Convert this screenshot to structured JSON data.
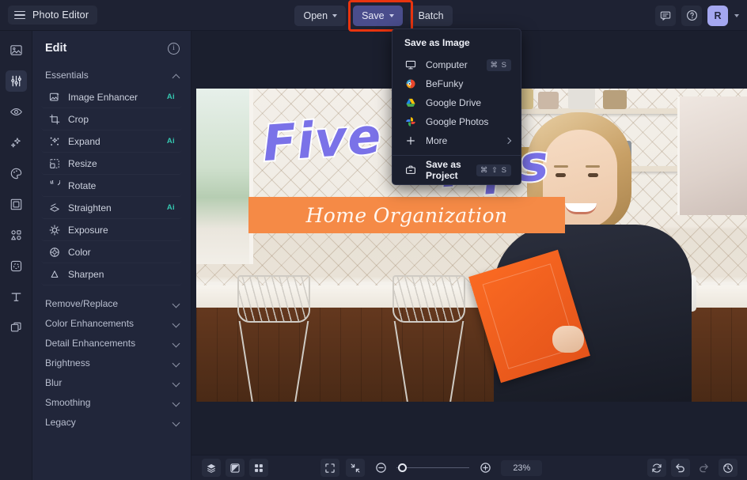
{
  "app": {
    "brand": "Photo Editor",
    "menu_icon": "hamburger-icon"
  },
  "toolbar": {
    "open_label": "Open",
    "save_label": "Save",
    "batch_label": "Batch",
    "highlight_color": "#e8340f",
    "save_active_color": "#4a4d8c"
  },
  "topright": {
    "feedback_icon": "comment-icon",
    "help_icon": "question-circle-icon",
    "avatar_initial": "R",
    "avatar_color": "#a4a7f0"
  },
  "rail": {
    "items": [
      {
        "icon": "image-icon",
        "active": false
      },
      {
        "icon": "sliders-icon",
        "active": true
      },
      {
        "icon": "eye-icon",
        "active": false
      },
      {
        "icon": "sparkles-icon",
        "active": false
      },
      {
        "icon": "palette-icon",
        "active": false
      },
      {
        "icon": "frame-icon",
        "active": false
      },
      {
        "icon": "shapes-icon",
        "active": false
      },
      {
        "icon": "sticker-icon",
        "active": false
      },
      {
        "icon": "text-icon",
        "active": false
      },
      {
        "icon": "layers-icon",
        "active": false
      }
    ]
  },
  "panel": {
    "title": "Edit",
    "info_icon": "info-icon",
    "group_label": "Essentials",
    "group_expanded": true,
    "items": [
      {
        "label": "Image Enhancer",
        "icon": "image-enhancer-icon",
        "badge": "Ai"
      },
      {
        "label": "Crop",
        "icon": "crop-icon",
        "badge": ""
      },
      {
        "label": "Expand",
        "icon": "expand-icon",
        "badge": "Ai"
      },
      {
        "label": "Resize",
        "icon": "resize-icon",
        "badge": ""
      },
      {
        "label": "Rotate",
        "icon": "rotate-icon",
        "badge": ""
      },
      {
        "label": "Straighten",
        "icon": "straighten-icon",
        "badge": "Ai"
      },
      {
        "label": "Exposure",
        "icon": "exposure-icon",
        "badge": ""
      },
      {
        "label": "Color",
        "icon": "color-wheel-icon",
        "badge": ""
      },
      {
        "label": "Sharpen",
        "icon": "sharpen-icon",
        "badge": ""
      }
    ],
    "collapsed_groups": [
      {
        "label": "Remove/Replace"
      },
      {
        "label": "Color Enhancements"
      },
      {
        "label": "Detail Enhancements"
      },
      {
        "label": "Brightness"
      },
      {
        "label": "Blur"
      },
      {
        "label": "Smoothing"
      },
      {
        "label": "Legacy"
      }
    ]
  },
  "save_menu": {
    "title": "Save as Image",
    "items": [
      {
        "label": "Computer",
        "icon": "monitor-icon",
        "shortcut": "⌘ S"
      },
      {
        "label": "BeFunky",
        "icon": "befunky-logo-icon",
        "shortcut": ""
      },
      {
        "label": "Google Drive",
        "icon": "google-drive-icon",
        "shortcut": ""
      },
      {
        "label": "Google Photos",
        "icon": "google-photos-icon",
        "shortcut": ""
      },
      {
        "label": "More",
        "icon": "plus-icon",
        "shortcut": "",
        "submenu": true
      }
    ],
    "project_item": {
      "label": "Save as Project",
      "icon": "briefcase-icon",
      "shortcut": "⌘ ⇧ S"
    }
  },
  "canvas_image": {
    "headline": "Five",
    "headline2": "Tips",
    "banner_text": "Home Organization",
    "headline_color": "#7a72e8",
    "banner_color": "#f58a46",
    "description": "Woman in a kitchen with wire bar stools holding an orange box"
  },
  "bottombar": {
    "left_tools": [
      {
        "icon": "layers-icon"
      },
      {
        "icon": "compare-icon"
      },
      {
        "icon": "grid-icon"
      }
    ],
    "view_tools": [
      {
        "icon": "fit-screen-icon"
      },
      {
        "icon": "actual-size-icon"
      }
    ],
    "zoom_out_icon": "zoom-out-icon",
    "zoom_in_icon": "zoom-in-icon",
    "zoom_value": "23%",
    "right_tools": [
      {
        "icon": "reset-icon",
        "enabled": true
      },
      {
        "icon": "undo-icon",
        "enabled": true
      },
      {
        "icon": "redo-icon",
        "enabled": false
      },
      {
        "icon": "history-icon",
        "enabled": true
      }
    ]
  }
}
